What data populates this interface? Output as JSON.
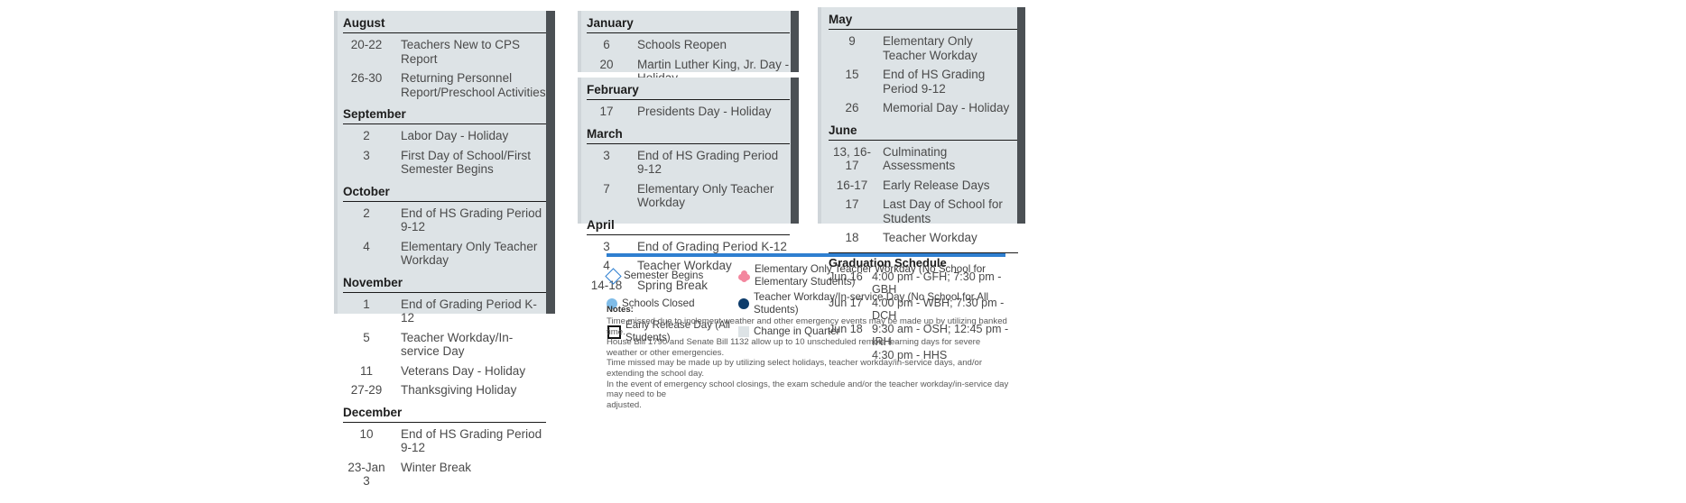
{
  "colors": {
    "panel_bg": "#dde3e6",
    "scroll_shadow": "#4b5054",
    "legend_bar": "#2f7fd0",
    "semester_begins": "#2f7fd0",
    "schools_closed": "#7fbce8",
    "early_release": "#111111",
    "elementary_workday": "#f3879f",
    "teacher_workday": "#0d3c6b",
    "change_in_quarter": "#dde3e6"
  },
  "column_one": {
    "months": [
      {
        "name": "August",
        "events": [
          {
            "date": "20-22",
            "desc": "Teachers New to CPS Report"
          },
          {
            "date": "26-30",
            "desc": "Returning Personnel Report/Preschool Activities"
          }
        ]
      },
      {
        "name": "September",
        "events": [
          {
            "date": "2",
            "desc": "Labor Day - Holiday"
          },
          {
            "date": "3",
            "desc": "First Day of School/First Semester Begins"
          }
        ]
      },
      {
        "name": "October",
        "events": [
          {
            "date": "2",
            "desc": "End of HS Grading Period 9-12"
          },
          {
            "date": "4",
            "desc": "Elementary Only Teacher Workday"
          }
        ]
      },
      {
        "name": "November",
        "events": [
          {
            "date": "1",
            "desc": "End of Grading Period K-12"
          },
          {
            "date": "5",
            "desc": "Teacher Workday/In-service Day"
          },
          {
            "date": "11",
            "desc": "Veterans Day - Holiday"
          },
          {
            "date": "27-29",
            "desc": "Thanksgiving Holiday"
          }
        ]
      },
      {
        "name": "December",
        "events": [
          {
            "date": "10",
            "desc": "End of HS Grading Period 9-12"
          },
          {
            "date": "23-Jan 3",
            "desc": "Winter Break"
          }
        ]
      }
    ]
  },
  "column_two_top": {
    "months": [
      {
        "name": "January",
        "events": [
          {
            "date": "6",
            "desc": "Schools Reopen"
          },
          {
            "date": "20",
            "desc": "Martin Luther King, Jr. Day - Holiday"
          }
        ]
      }
    ]
  },
  "column_two_bottom": {
    "months": [
      {
        "name": "February",
        "events": [
          {
            "date": "17",
            "desc": "Presidents Day - Holiday"
          }
        ]
      },
      {
        "name": "March",
        "events": [
          {
            "date": "3",
            "desc": "End of HS Grading Period 9-12"
          },
          {
            "date": "7",
            "desc": "Elementary Only Teacher Workday"
          }
        ]
      },
      {
        "name": "April",
        "events": [
          {
            "date": "3",
            "desc": "End of Grading Period K-12"
          },
          {
            "date": "4",
            "desc": "Teacher Workday"
          },
          {
            "date": "14-18",
            "desc": "Spring Break"
          }
        ]
      }
    ]
  },
  "column_three": {
    "months": [
      {
        "name": "May",
        "events": [
          {
            "date": "9",
            "desc": "Elementary Only Teacher Workday"
          },
          {
            "date": "15",
            "desc": "End of HS Grading Period 9-12"
          },
          {
            "date": "26",
            "desc": "Memorial Day - Holiday"
          }
        ]
      },
      {
        "name": "June",
        "events": [
          {
            "date": "13, 16-17",
            "desc": "Culminating Assessments"
          },
          {
            "date": "16-17",
            "desc": "Early Release Days"
          },
          {
            "date": "17",
            "desc": "Last Day of School for Students"
          },
          {
            "date": "18",
            "desc": "Teacher Workday"
          }
        ]
      }
    ],
    "graduation": {
      "title": "Graduation Schedule",
      "rows": [
        {
          "day": "Jun 16",
          "detail": "4:00 pm - GFH; 7:30 pm - GBH"
        },
        {
          "day": "Jun 17",
          "detail": "4:00 pm - WBH; 7:30 pm - DCH"
        },
        {
          "day": "Jun 18",
          "detail": "9:30 am - OSH; 12:45 pm - IRH"
        }
      ],
      "continuation": "4:30 pm - HHS"
    }
  },
  "legend": {
    "items_left": [
      {
        "icon": "diamond-outline-icon",
        "label": "Semester Begins"
      },
      {
        "icon": "light-blue-circle-icon",
        "label": "Schools Closed"
      },
      {
        "icon": "black-square-outline-icon",
        "label": "Early Release Day (All Students)"
      }
    ],
    "items_right": [
      {
        "icon": "pink-flower-icon",
        "label": "Elementary Only Teacher Workday (No School for Elementary Students)"
      },
      {
        "icon": "navy-circle-icon",
        "label": "Teacher Workday/In-service Day (No School for All Students)"
      },
      {
        "icon": "grey-square-icon",
        "label": "Change in Quarter"
      }
    ]
  },
  "notes": {
    "title": "Notes:",
    "lines": [
      "Time missed due to inclement weather and other emergency events may be made up by utilizing banked time.",
      "House Bill 1790 and Senate Bill 1132 allow up to 10 unscheduled remote learning days for severe weather or other emergencies.",
      "Time missed may be made up by utilizing select holidays, teacher workday/in-service days, and/or extending the school day.",
      "In the event of emergency school closings, the exam schedule and/or the teacher workday/in-service day may need to be",
      "adjusted."
    ]
  }
}
